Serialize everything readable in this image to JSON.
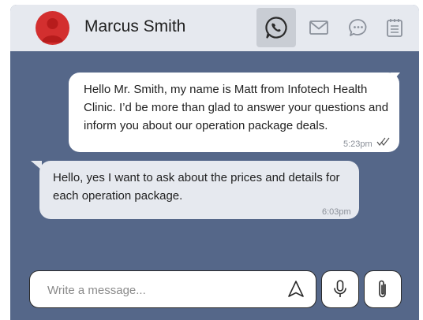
{
  "contact": {
    "name": "Marcus Smith"
  },
  "channels": [
    {
      "icon": "whatsapp-icon",
      "active": true
    },
    {
      "icon": "mail-icon",
      "active": false
    },
    {
      "icon": "chat-bubble-icon",
      "active": false
    },
    {
      "icon": "notes-icon",
      "active": false
    }
  ],
  "messages": [
    {
      "direction": "outgoing",
      "text": "Hello Mr. Smith, my name is Matt from Infotech Health Clinic. I’d be more than glad to answer your questions and inform you about our operation package deals.",
      "time": "5:23pm",
      "status": "read"
    },
    {
      "direction": "incoming",
      "text": "Hello, yes I want to ask about the prices and details for each operation package.",
      "time": "6:03pm"
    }
  ],
  "composer": {
    "placeholder": "Write a message..."
  },
  "colors": {
    "header_bg": "#e6e9ef",
    "chat_bg": "#556789",
    "avatar_red": "#d32f2f",
    "incoming_bubble": "#e6e9ef",
    "outgoing_bubble": "#ffffff"
  }
}
